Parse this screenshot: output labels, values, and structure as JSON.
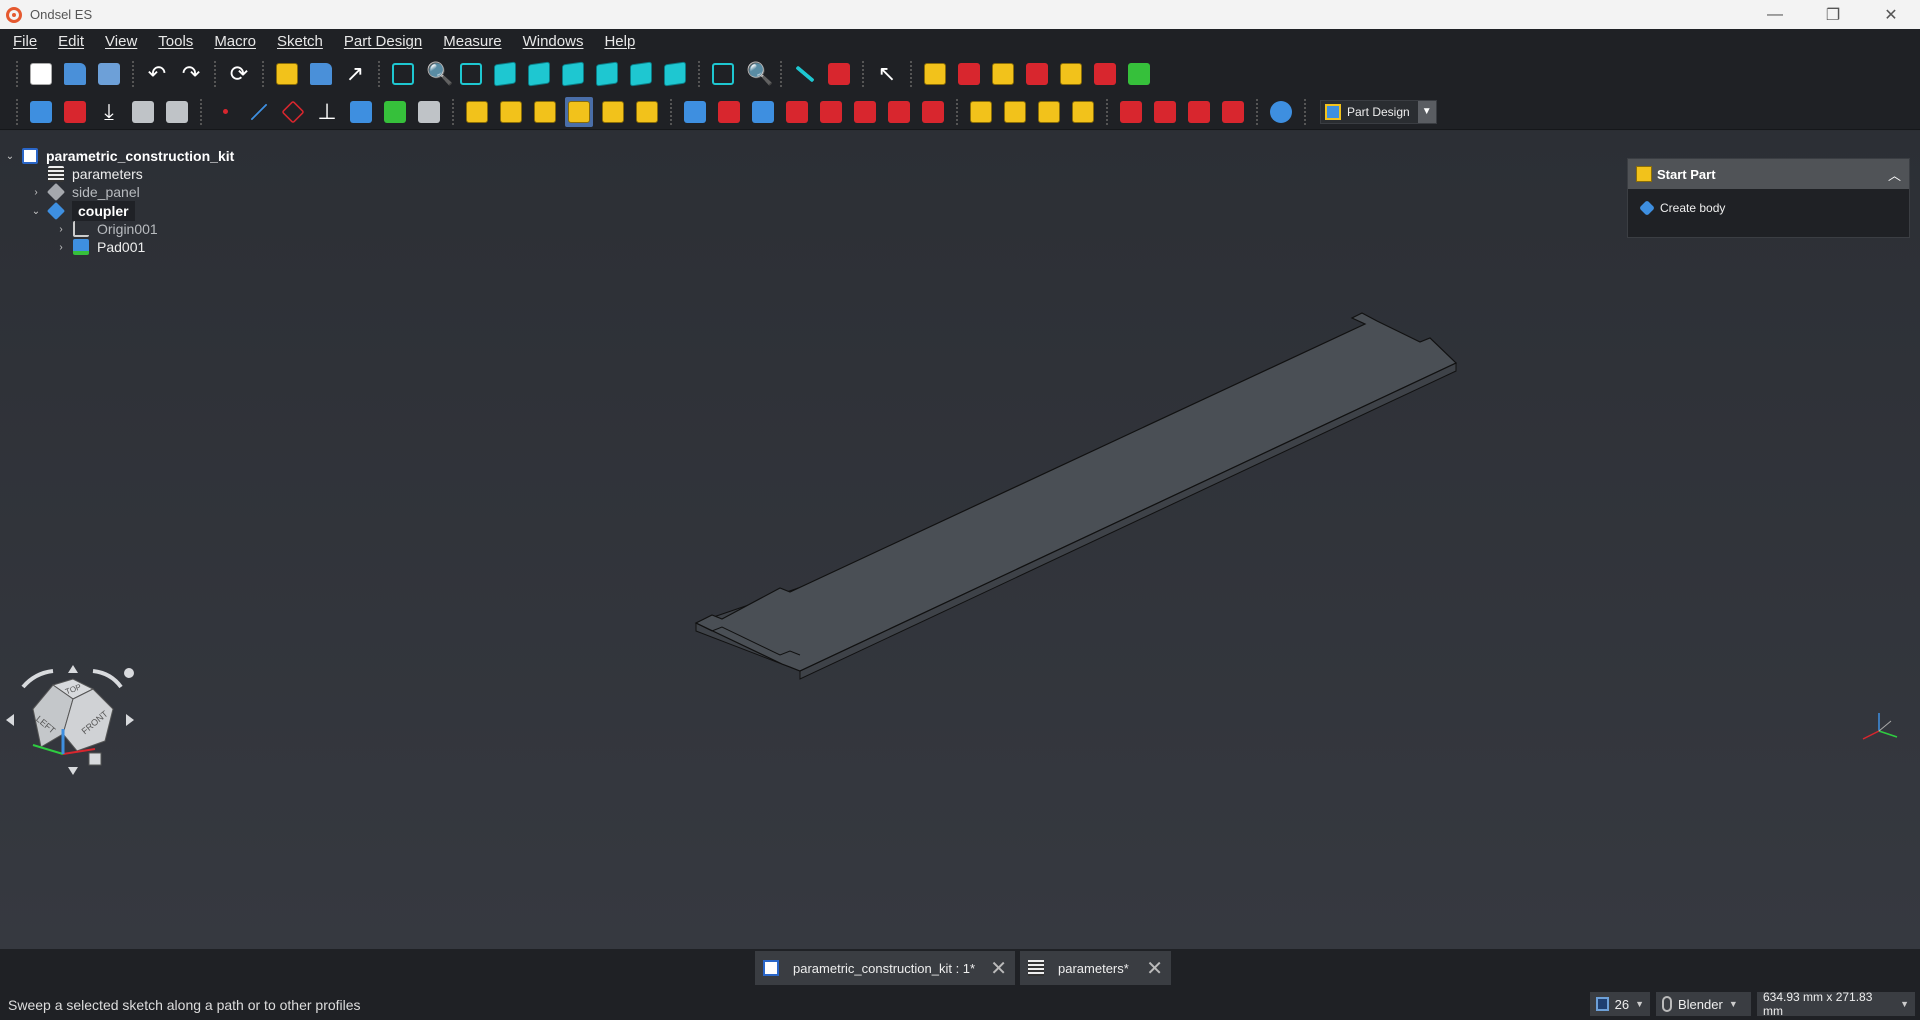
{
  "window": {
    "title": "Ondsel ES",
    "controls": [
      "—",
      "❐",
      "✕"
    ]
  },
  "menu": [
    "File",
    "Edit",
    "View",
    "Tools",
    "Macro",
    "Sketch",
    "Part Design",
    "Measure",
    "Windows",
    "Help"
  ],
  "workbench": {
    "selected": "Part Design"
  },
  "tree": {
    "document": "parametric_construction_kit",
    "items": [
      {
        "label": "parameters"
      },
      {
        "label": "side_panel"
      },
      {
        "label": "coupler"
      },
      {
        "label": "Origin001"
      },
      {
        "label": "Pad001"
      }
    ]
  },
  "task_panel": {
    "header": "Start Part",
    "action": "Create body"
  },
  "navcube": {
    "top": "TOP",
    "left": "LEFT",
    "front": "FRONT"
  },
  "tabs": [
    {
      "label": "parametric_construction_kit : 1*"
    },
    {
      "label": "parameters*"
    }
  ],
  "status": {
    "message": "Sweep a selected sketch along a path or to other profiles",
    "layer_count": "26",
    "nav_style": "Blender",
    "dimensions": "634.93 mm x 271.83 mm"
  },
  "colors": {
    "accent": "#4a6ea8",
    "panel_dark": "#1f2125",
    "model_face": "#4a4f55"
  }
}
